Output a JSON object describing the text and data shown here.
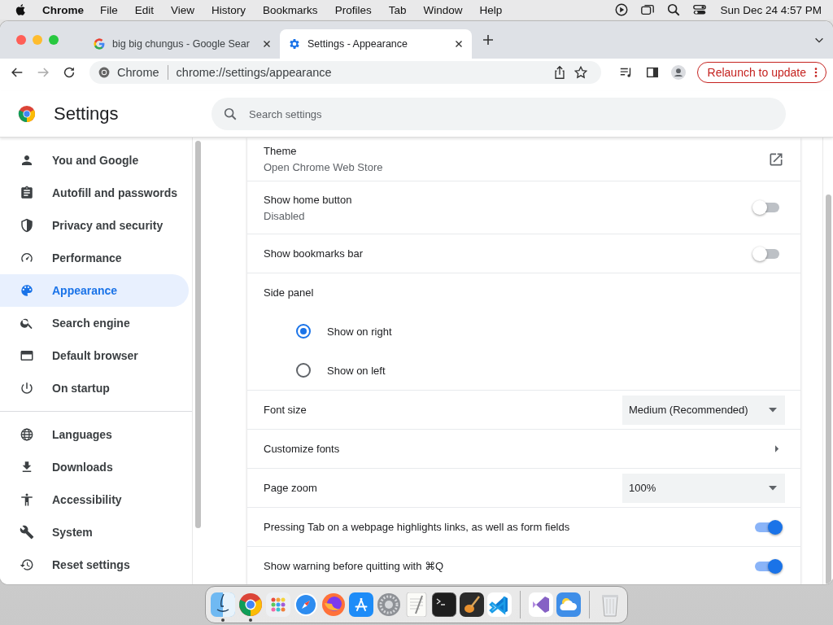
{
  "menubar": {
    "app": "Chrome",
    "menus": [
      "File",
      "Edit",
      "View",
      "History",
      "Bookmarks",
      "Profiles",
      "Tab",
      "Window",
      "Help"
    ],
    "clock": "Sun Dec 24  4:57 PM"
  },
  "tabs": [
    {
      "title": "big big chungus - Google Sear",
      "kind": "google",
      "selected": false
    },
    {
      "title": "Settings - Appearance",
      "kind": "gear",
      "selected": true
    }
  ],
  "address": {
    "site": "Chrome",
    "url": "chrome://settings/appearance"
  },
  "relaunch_button": "Relaunch to update",
  "header": {
    "title": "Settings",
    "search_placeholder": "Search settings"
  },
  "sidebar": {
    "groups": [
      [
        {
          "label": "You and Google",
          "kind": "person",
          "selected": false
        },
        {
          "label": "Autofill and passwords",
          "kind": "clipboard",
          "selected": false
        },
        {
          "label": "Privacy and security",
          "kind": "shield",
          "selected": false
        },
        {
          "label": "Performance",
          "kind": "gauge",
          "selected": false
        },
        {
          "label": "Appearance",
          "kind": "palette",
          "selected": true
        },
        {
          "label": "Search engine",
          "kind": "search",
          "selected": false
        },
        {
          "label": "Default browser",
          "kind": "browser",
          "selected": false
        },
        {
          "label": "On startup",
          "kind": "power",
          "selected": false
        }
      ],
      [
        {
          "label": "Languages",
          "kind": "globe",
          "selected": false
        },
        {
          "label": "Downloads",
          "kind": "download",
          "selected": false
        },
        {
          "label": "Accessibility",
          "kind": "accessibility",
          "selected": false
        },
        {
          "label": "System",
          "kind": "wrench",
          "selected": false
        },
        {
          "label": "Reset settings",
          "kind": "reset",
          "selected": false
        }
      ]
    ]
  },
  "rows": [
    {
      "kind": "link",
      "title": "Theme",
      "subtitle": "Open Chrome Web Store"
    },
    {
      "kind": "toggle",
      "title": "Show home button",
      "subtitle": "Disabled",
      "on": false
    },
    {
      "kind": "toggle",
      "title": "Show bookmarks bar",
      "on": false
    },
    {
      "kind": "heading",
      "title": "Side panel"
    },
    {
      "kind": "radio",
      "title": "Show on right",
      "selected": true
    },
    {
      "kind": "radio",
      "title": "Show on left",
      "selected": false
    },
    {
      "kind": "select",
      "title": "Font size",
      "value": "Medium (Recommended)"
    },
    {
      "kind": "arrow",
      "title": "Customize fonts"
    },
    {
      "kind": "select",
      "title": "Page zoom",
      "value": "100%"
    },
    {
      "kind": "toggle",
      "title": "Pressing Tab on a webpage highlights links, as well as form fields",
      "on": true
    },
    {
      "kind": "toggle",
      "title": "Show warning before quitting with ⌘Q",
      "on": true
    }
  ],
  "dock": {
    "groups": [
      [
        {
          "kind": "finder",
          "running": true
        },
        {
          "kind": "chrome",
          "running": true
        },
        {
          "kind": "launchpad",
          "running": false
        },
        {
          "kind": "safari",
          "running": false
        },
        {
          "kind": "firefox",
          "running": false
        },
        {
          "kind": "appstore",
          "running": false
        },
        {
          "kind": "settings",
          "running": false
        },
        {
          "kind": "textedit",
          "running": false
        },
        {
          "kind": "terminal",
          "running": false
        },
        {
          "kind": "garageband",
          "running": false
        },
        {
          "kind": "vscode",
          "running": false
        }
      ],
      [
        {
          "kind": "vs",
          "running": false
        },
        {
          "kind": "weather",
          "running": false
        }
      ],
      [
        {
          "kind": "trash",
          "running": false
        }
      ]
    ]
  }
}
